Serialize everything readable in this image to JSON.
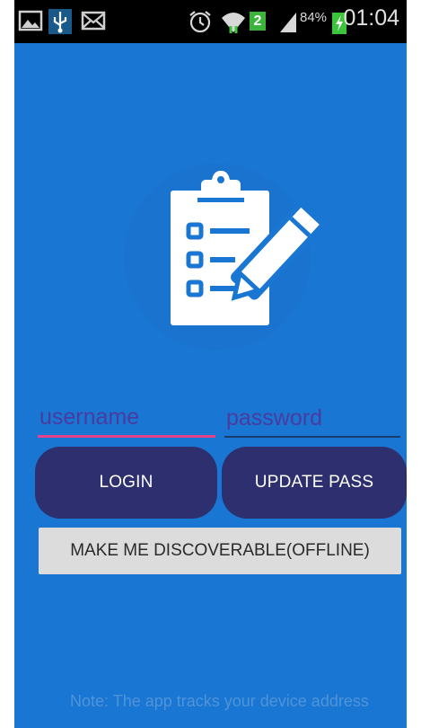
{
  "status_bar": {
    "left_icons": [
      "gallery-icon",
      "usb-icon",
      "mail-icon"
    ],
    "right_icons": [
      "alarm-icon",
      "wifi-icon",
      "sim-badge-icon",
      "signal-icon",
      "battery-charging-icon"
    ],
    "sim_badge": "2",
    "battery_percent": "84%",
    "time": "01:04"
  },
  "logo": {
    "icon": "clipboard-pencil-icon"
  },
  "login_form": {
    "username_placeholder": "username",
    "password_placeholder": "password",
    "username_value": "",
    "password_value": ""
  },
  "buttons": {
    "login_label": "LOGIN",
    "update_pass_label": "UPDATE PASS",
    "discoverable_label": "MAKE ME DISCOVERABLE(OFFLINE)"
  },
  "footer": {
    "note": "Note: The app tracks your device address"
  },
  "colors": {
    "background": "#1976d2",
    "button_primary": "#2d2f6f",
    "button_secondary": "#dcdcdc",
    "username_underline": "#e3428a",
    "status_bar": "#000000"
  }
}
